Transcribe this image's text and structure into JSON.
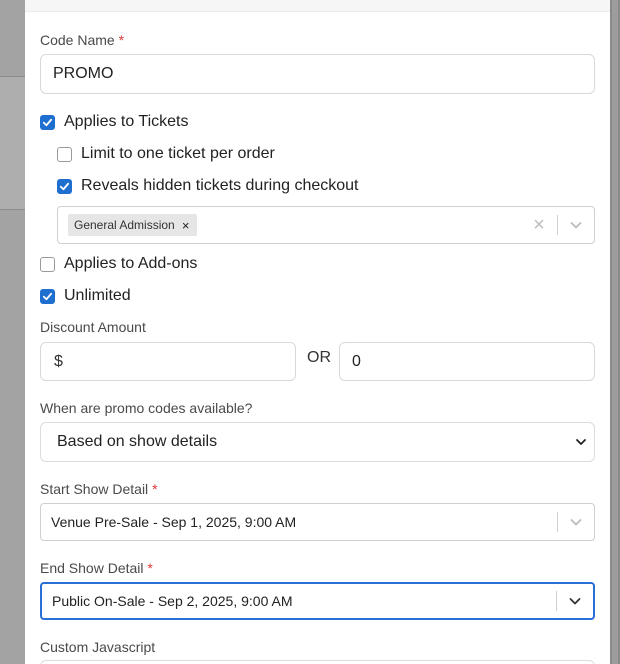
{
  "form": {
    "code_name": {
      "label": "Code Name",
      "required_mark": "*",
      "value": "PROMO"
    },
    "applies_tickets": {
      "label": "Applies to Tickets",
      "checked": true
    },
    "limit_one": {
      "label": "Limit to one ticket per order",
      "checked": false
    },
    "reveals_hidden": {
      "label": "Reveals hidden tickets during checkout",
      "checked": true
    },
    "ticket_select": {
      "tags": [
        "General Admission"
      ],
      "tag_remove": "×",
      "clear": "×"
    },
    "applies_addons": {
      "label": "Applies to Add-ons",
      "checked": false
    },
    "unlimited": {
      "label": "Unlimited",
      "checked": true
    },
    "discount": {
      "label": "Discount Amount",
      "currency_placeholder": "$",
      "or_label": "OR",
      "percent_value": "0"
    },
    "availability": {
      "label": "When are promo codes available?",
      "value": "Based on show details"
    },
    "start_show": {
      "label": "Start Show Detail",
      "required_mark": "*",
      "value": "Venue Pre-Sale - Sep 1, 2025, 9:00 AM"
    },
    "end_show": {
      "label": "End Show Detail",
      "required_mark": "*",
      "value": "Public On-Sale - Sep 2, 2025, 9:00 AM"
    },
    "custom_js": {
      "label": "Custom Javascript"
    }
  },
  "colors": {
    "accent": "#1f6fd1",
    "required": "#dd3333",
    "focus": "#2a6fd6"
  }
}
